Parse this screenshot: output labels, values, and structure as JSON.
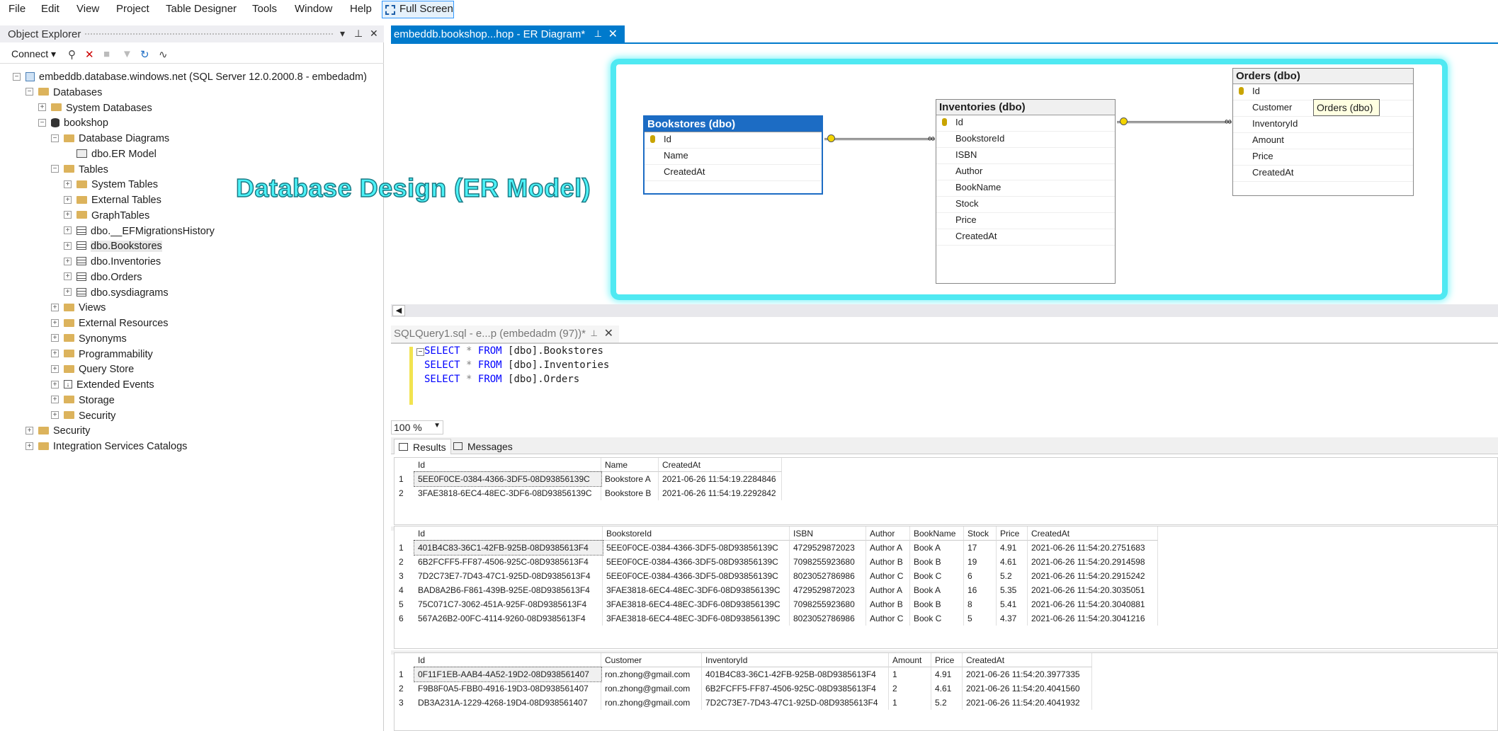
{
  "menu": {
    "items": [
      "File",
      "Edit",
      "View",
      "Project",
      "Table Designer",
      "Tools",
      "Window",
      "Help"
    ],
    "full_screen": "Full Screen"
  },
  "object_explorer": {
    "title": "Object Explorer",
    "connect": "Connect",
    "tree": [
      {
        "label": "embeddb.database.windows.net (SQL Server 12.0.2000.8 - embedadm)",
        "level": 0,
        "expanded": true,
        "icon": "server-icon"
      },
      {
        "label": "Databases",
        "level": 1,
        "expanded": true,
        "icon": "folder-icon"
      },
      {
        "label": "System Databases",
        "level": 2,
        "expanded": false,
        "icon": "folder-icon"
      },
      {
        "label": "bookshop",
        "level": 2,
        "expanded": true,
        "icon": "database-icon"
      },
      {
        "label": "Database Diagrams",
        "level": 3,
        "expanded": true,
        "icon": "folder-icon"
      },
      {
        "label": "dbo.ER Model",
        "level": 4,
        "expanded": null,
        "icon": "diagram-icon"
      },
      {
        "label": "Tables",
        "level": 3,
        "expanded": true,
        "icon": "folder-icon"
      },
      {
        "label": "System Tables",
        "level": 4,
        "expanded": false,
        "icon": "folder-icon"
      },
      {
        "label": "External Tables",
        "level": 4,
        "expanded": false,
        "icon": "folder-icon"
      },
      {
        "label": "GraphTables",
        "level": 4,
        "expanded": false,
        "icon": "folder-icon"
      },
      {
        "label": "dbo.__EFMigrationsHistory",
        "level": 4,
        "expanded": false,
        "icon": "table-icon"
      },
      {
        "label": "dbo.Bookstores",
        "level": 4,
        "expanded": false,
        "icon": "table-icon",
        "selected": true
      },
      {
        "label": "dbo.Inventories",
        "level": 4,
        "expanded": false,
        "icon": "table-icon"
      },
      {
        "label": "dbo.Orders",
        "level": 4,
        "expanded": false,
        "icon": "table-icon"
      },
      {
        "label": "dbo.sysdiagrams",
        "level": 4,
        "expanded": false,
        "icon": "table-icon"
      },
      {
        "label": "Views",
        "level": 3,
        "expanded": false,
        "icon": "folder-icon"
      },
      {
        "label": "External Resources",
        "level": 3,
        "expanded": false,
        "icon": "folder-icon"
      },
      {
        "label": "Synonyms",
        "level": 3,
        "expanded": false,
        "icon": "folder-icon"
      },
      {
        "label": "Programmability",
        "level": 3,
        "expanded": false,
        "icon": "folder-icon"
      },
      {
        "label": "Query Store",
        "level": 3,
        "expanded": false,
        "icon": "folder-icon"
      },
      {
        "label": "Extended Events",
        "level": 3,
        "expanded": false,
        "icon": "events-icon"
      },
      {
        "label": "Storage",
        "level": 3,
        "expanded": false,
        "icon": "folder-icon"
      },
      {
        "label": "Security",
        "level": 3,
        "expanded": false,
        "icon": "folder-icon"
      },
      {
        "label": "Security",
        "level": 1,
        "expanded": false,
        "icon": "folder-icon"
      },
      {
        "label": "Integration Services Catalogs",
        "level": 1,
        "expanded": false,
        "icon": "folder-icon"
      }
    ]
  },
  "er_tab": {
    "title": "embeddb.bookshop...hop - ER Diagram*"
  },
  "overlay_title": "Database Design (ER Model)",
  "er_tables": {
    "bookstores": {
      "title": "Bookstores (dbo)",
      "columns": [
        "Id",
        "Name",
        "CreatedAt"
      ]
    },
    "inventories": {
      "title": "Inventories (dbo)",
      "columns": [
        "Id",
        "BookstoreId",
        "ISBN",
        "Author",
        "BookName",
        "Stock",
        "Price",
        "CreatedAt"
      ]
    },
    "orders": {
      "title": "Orders (dbo)",
      "columns": [
        "Id",
        "Customer",
        "InventoryId",
        "Amount",
        "Price",
        "CreatedAt"
      ]
    }
  },
  "tooltip": "Orders (dbo)",
  "sql_tab": {
    "title": "SQLQuery1.sql - e...p (embedadm (97))*"
  },
  "sql_lines": [
    {
      "kw1": "SELECT",
      "star": "*",
      "kw2": "FROM",
      "obj": "[dbo].Bookstores"
    },
    {
      "kw1": "SELECT",
      "star": "*",
      "kw2": "FROM",
      "obj": "[dbo].Inventories"
    },
    {
      "kw1": "SELECT",
      "star": "*",
      "kw2": "FROM",
      "obj": "[dbo].Orders"
    }
  ],
  "zoom": "100 %",
  "result_tabs": {
    "results": "Results",
    "messages": "Messages"
  },
  "grids": {
    "bookstores": {
      "columns": [
        "Id",
        "Name",
        "CreatedAt"
      ],
      "rows": [
        [
          "5EE0F0CE-0384-4366-3DF5-08D93856139C",
          "Bookstore A",
          "2021-06-26 11:54:19.2284846"
        ],
        [
          "3FAE3818-6EC4-48EC-3DF6-08D93856139C",
          "Bookstore B",
          "2021-06-26 11:54:19.2292842"
        ]
      ]
    },
    "inventories": {
      "columns": [
        "Id",
        "BookstoreId",
        "ISBN",
        "Author",
        "BookName",
        "Stock",
        "Price",
        "CreatedAt"
      ],
      "rows": [
        [
          "401B4C83-36C1-42FB-925B-08D9385613F4",
          "5EE0F0CE-0384-4366-3DF5-08D93856139C",
          "4729529872023",
          "Author A",
          "Book A",
          "17",
          "4.91",
          "2021-06-26 11:54:20.2751683"
        ],
        [
          "6B2FCFF5-FF87-4506-925C-08D9385613F4",
          "5EE0F0CE-0384-4366-3DF5-08D93856139C",
          "7098255923680",
          "Author B",
          "Book B",
          "19",
          "4.61",
          "2021-06-26 11:54:20.2914598"
        ],
        [
          "7D2C73E7-7D43-47C1-925D-08D9385613F4",
          "5EE0F0CE-0384-4366-3DF5-08D93856139C",
          "8023052786986",
          "Author C",
          "Book C",
          "6",
          "5.2",
          "2021-06-26 11:54:20.2915242"
        ],
        [
          "BAD8A2B6-F861-439B-925E-08D9385613F4",
          "3FAE3818-6EC4-48EC-3DF6-08D93856139C",
          "4729529872023",
          "Author A",
          "Book A",
          "16",
          "5.35",
          "2021-06-26 11:54:20.3035051"
        ],
        [
          "75C071C7-3062-451A-925F-08D9385613F4",
          "3FAE3818-6EC4-48EC-3DF6-08D93856139C",
          "7098255923680",
          "Author B",
          "Book B",
          "8",
          "5.41",
          "2021-06-26 11:54:20.3040881"
        ],
        [
          "567A26B2-00FC-4114-9260-08D9385613F4",
          "3FAE3818-6EC4-48EC-3DF6-08D93856139C",
          "8023052786986",
          "Author C",
          "Book C",
          "5",
          "4.37",
          "2021-06-26 11:54:20.3041216"
        ]
      ]
    },
    "orders": {
      "columns": [
        "Id",
        "Customer",
        "InventoryId",
        "Amount",
        "Price",
        "CreatedAt"
      ],
      "rows": [
        [
          "0F11F1EB-AAB4-4A52-19D2-08D938561407",
          "ron.zhong@gmail.com",
          "401B4C83-36C1-42FB-925B-08D9385613F4",
          "1",
          "4.91",
          "2021-06-26 11:54:20.3977335"
        ],
        [
          "F9B8F0A5-FBB0-4916-19D3-08D938561407",
          "ron.zhong@gmail.com",
          "6B2FCFF5-FF87-4506-925C-08D9385613F4",
          "2",
          "4.61",
          "2021-06-26 11:54:20.4041560"
        ],
        [
          "DB3A231A-1229-4268-19D4-08D938561407",
          "ron.zhong@gmail.com",
          "7D2C73E7-7D43-47C1-925D-08D9385613F4",
          "1",
          "5.2",
          "2021-06-26 11:54:20.4041932"
        ]
      ]
    }
  }
}
